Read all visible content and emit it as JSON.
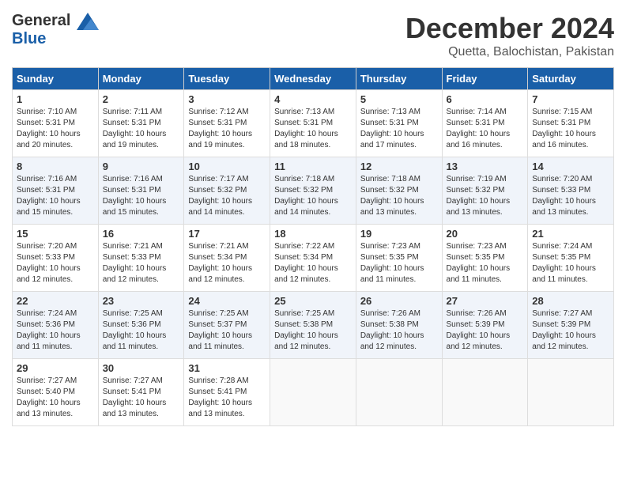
{
  "header": {
    "logo_line1": "General",
    "logo_line2": "Blue",
    "month_title": "December 2024",
    "subtitle": "Quetta, Balochistan, Pakistan"
  },
  "days_of_week": [
    "Sunday",
    "Monday",
    "Tuesday",
    "Wednesday",
    "Thursday",
    "Friday",
    "Saturday"
  ],
  "weeks": [
    [
      {
        "num": "1",
        "sunrise": "7:10 AM",
        "sunset": "5:31 PM",
        "daylight": "10 hours and 20 minutes."
      },
      {
        "num": "2",
        "sunrise": "7:11 AM",
        "sunset": "5:31 PM",
        "daylight": "10 hours and 19 minutes."
      },
      {
        "num": "3",
        "sunrise": "7:12 AM",
        "sunset": "5:31 PM",
        "daylight": "10 hours and 19 minutes."
      },
      {
        "num": "4",
        "sunrise": "7:13 AM",
        "sunset": "5:31 PM",
        "daylight": "10 hours and 18 minutes."
      },
      {
        "num": "5",
        "sunrise": "7:13 AM",
        "sunset": "5:31 PM",
        "daylight": "10 hours and 17 minutes."
      },
      {
        "num": "6",
        "sunrise": "7:14 AM",
        "sunset": "5:31 PM",
        "daylight": "10 hours and 16 minutes."
      },
      {
        "num": "7",
        "sunrise": "7:15 AM",
        "sunset": "5:31 PM",
        "daylight": "10 hours and 16 minutes."
      }
    ],
    [
      {
        "num": "8",
        "sunrise": "7:16 AM",
        "sunset": "5:31 PM",
        "daylight": "10 hours and 15 minutes."
      },
      {
        "num": "9",
        "sunrise": "7:16 AM",
        "sunset": "5:31 PM",
        "daylight": "10 hours and 15 minutes."
      },
      {
        "num": "10",
        "sunrise": "7:17 AM",
        "sunset": "5:32 PM",
        "daylight": "10 hours and 14 minutes."
      },
      {
        "num": "11",
        "sunrise": "7:18 AM",
        "sunset": "5:32 PM",
        "daylight": "10 hours and 14 minutes."
      },
      {
        "num": "12",
        "sunrise": "7:18 AM",
        "sunset": "5:32 PM",
        "daylight": "10 hours and 13 minutes."
      },
      {
        "num": "13",
        "sunrise": "7:19 AM",
        "sunset": "5:32 PM",
        "daylight": "10 hours and 13 minutes."
      },
      {
        "num": "14",
        "sunrise": "7:20 AM",
        "sunset": "5:33 PM",
        "daylight": "10 hours and 13 minutes."
      }
    ],
    [
      {
        "num": "15",
        "sunrise": "7:20 AM",
        "sunset": "5:33 PM",
        "daylight": "10 hours and 12 minutes."
      },
      {
        "num": "16",
        "sunrise": "7:21 AM",
        "sunset": "5:33 PM",
        "daylight": "10 hours and 12 minutes."
      },
      {
        "num": "17",
        "sunrise": "7:21 AM",
        "sunset": "5:34 PM",
        "daylight": "10 hours and 12 minutes."
      },
      {
        "num": "18",
        "sunrise": "7:22 AM",
        "sunset": "5:34 PM",
        "daylight": "10 hours and 12 minutes."
      },
      {
        "num": "19",
        "sunrise": "7:23 AM",
        "sunset": "5:35 PM",
        "daylight": "10 hours and 11 minutes."
      },
      {
        "num": "20",
        "sunrise": "7:23 AM",
        "sunset": "5:35 PM",
        "daylight": "10 hours and 11 minutes."
      },
      {
        "num": "21",
        "sunrise": "7:24 AM",
        "sunset": "5:35 PM",
        "daylight": "10 hours and 11 minutes."
      }
    ],
    [
      {
        "num": "22",
        "sunrise": "7:24 AM",
        "sunset": "5:36 PM",
        "daylight": "10 hours and 11 minutes."
      },
      {
        "num": "23",
        "sunrise": "7:25 AM",
        "sunset": "5:36 PM",
        "daylight": "10 hours and 11 minutes."
      },
      {
        "num": "24",
        "sunrise": "7:25 AM",
        "sunset": "5:37 PM",
        "daylight": "10 hours and 11 minutes."
      },
      {
        "num": "25",
        "sunrise": "7:25 AM",
        "sunset": "5:38 PM",
        "daylight": "10 hours and 12 minutes."
      },
      {
        "num": "26",
        "sunrise": "7:26 AM",
        "sunset": "5:38 PM",
        "daylight": "10 hours and 12 minutes."
      },
      {
        "num": "27",
        "sunrise": "7:26 AM",
        "sunset": "5:39 PM",
        "daylight": "10 hours and 12 minutes."
      },
      {
        "num": "28",
        "sunrise": "7:27 AM",
        "sunset": "5:39 PM",
        "daylight": "10 hours and 12 minutes."
      }
    ],
    [
      {
        "num": "29",
        "sunrise": "7:27 AM",
        "sunset": "5:40 PM",
        "daylight": "10 hours and 13 minutes."
      },
      {
        "num": "30",
        "sunrise": "7:27 AM",
        "sunset": "5:41 PM",
        "daylight": "10 hours and 13 minutes."
      },
      {
        "num": "31",
        "sunrise": "7:28 AM",
        "sunset": "5:41 PM",
        "daylight": "10 hours and 13 minutes."
      },
      null,
      null,
      null,
      null
    ]
  ]
}
